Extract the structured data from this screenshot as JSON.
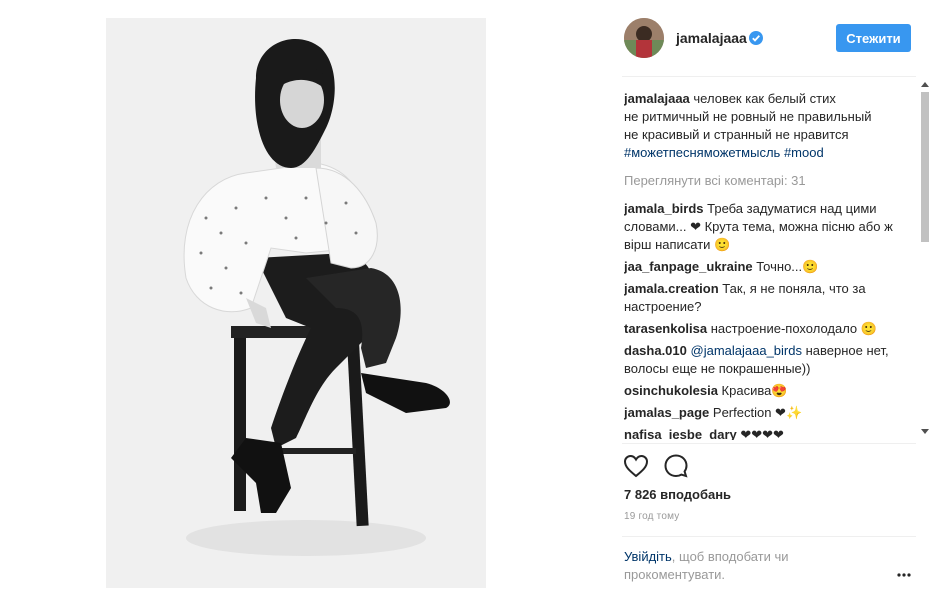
{
  "post": {
    "username": "jamalajaaa",
    "follow_label": "Стежити"
  },
  "caption": {
    "author": "jamalajaaa",
    "lines": [
      "человек как белый стих",
      "не ритмичный не ровный не правильный",
      "не красивый и странный не нравится"
    ],
    "hashtags": [
      "#можетпесняможетмысль",
      "#mood"
    ]
  },
  "view_all_comments": "Переглянути всі коментарі: 31",
  "comments": [
    {
      "author": "jamala_birds",
      "text": "Треба задуматися над цими словами... ❤ Крута тема, можна пісню або ж вірш написати 🙂"
    },
    {
      "author": "jaa_fanpage_ukraine",
      "text": "Точно...🙂"
    },
    {
      "author": "jamala.creation",
      "text": "Так, я не поняла, что за настроение?"
    },
    {
      "author": "tarasenkolisa",
      "text": "настроение-похолодало 🙂"
    },
    {
      "author": "dasha.010",
      "mention": "@jamalajaaa_birds",
      "text": "наверное нет, волосы еще не покрашенные))"
    },
    {
      "author": "osinchukolesia",
      "text": "Красива😍"
    },
    {
      "author": "jamalas_page",
      "text": "Perfection ❤✨"
    },
    {
      "author": "nafisa_iesbe_dary",
      "text": "❤❤❤❤"
    }
  ],
  "stats": {
    "likes": "7 826 вподобань",
    "time": "19 год тому"
  },
  "login_prompt": {
    "link": "Увійдіть",
    "rest": ", щоб вподобати чи прокоментувати."
  },
  "icons": {
    "verified": "verified-badge-icon",
    "like": "heart-icon",
    "comment": "comment-bubble-icon",
    "more": "more-dots-icon"
  },
  "colors": {
    "accent": "#3897f0",
    "link": "#003569",
    "muted": "#999999",
    "text": "#262626"
  }
}
